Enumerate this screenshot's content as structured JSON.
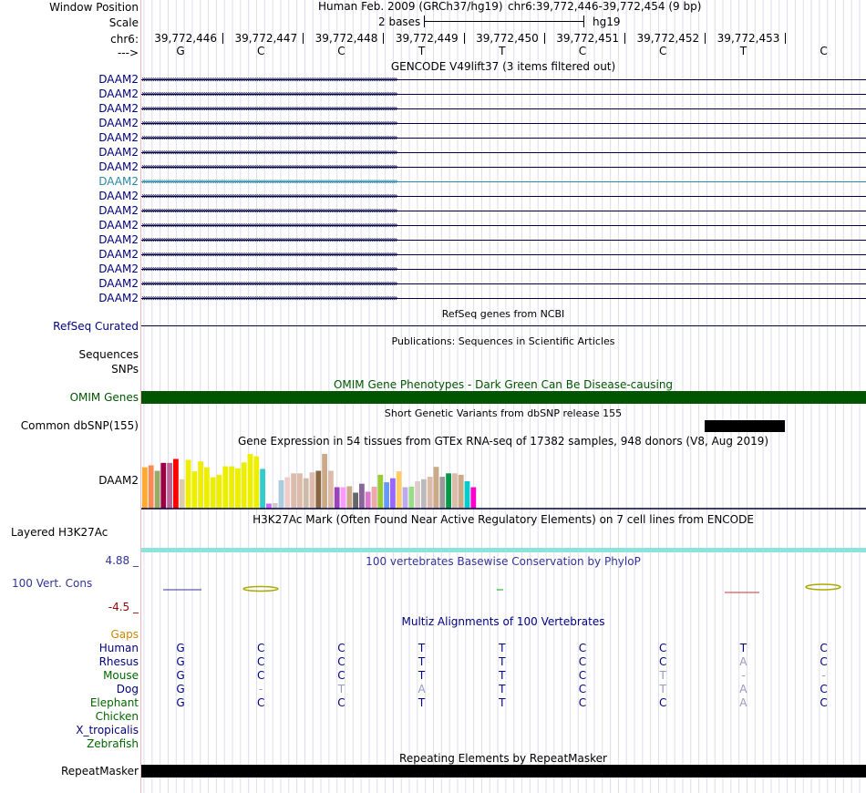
{
  "header": {
    "window_position_label": "Window Position",
    "scale_label": "Scale",
    "chrom_label": "chr6:",
    "strand_label": "--->",
    "assembly_text": "Human Feb. 2009 (GRCh37/hg19)",
    "position_text": "chr6:39,772,446-39,772,454 (9 bp)",
    "scale_bases": "2 bases",
    "scale_db": "hg19",
    "coordinates": [
      "39,772,446",
      "39,772,447",
      "39,772,448",
      "39,772,449",
      "39,772,450",
      "39,772,451",
      "39,772,452",
      "39,772,453"
    ],
    "bases": [
      "G",
      "C",
      "C",
      "T",
      "T",
      "C",
      "C",
      "T",
      "C"
    ]
  },
  "gencode": {
    "title": "GENCODE V49lift37 (3 items filtered out)",
    "gene_label": "DAAM2",
    "row_count": 16,
    "highlighted_row": 7,
    "colors": {
      "gene": "#000080",
      "highlight": "#2a87a8"
    }
  },
  "refseq": {
    "label": "RefSeq Curated",
    "title": "RefSeq genes from NCBI"
  },
  "publications": {
    "title": "Publications: Sequences in Scientific Articles",
    "sequences_label": "Sequences",
    "snps_label": "SNPs"
  },
  "omim": {
    "label": "OMIM Genes",
    "title": "OMIM Gene Phenotypes - Dark Green Can Be Disease-causing",
    "color": "#005500"
  },
  "dbsnp": {
    "label": "Common dbSNP(155)",
    "title": "Short Genetic Variants from dbSNP release 155"
  },
  "gtex": {
    "label": "DAAM2",
    "title": "Gene Expression in 54 tissues from GTEx RNA-seq of 17382 samples, 948 donors (V8, Aug 2019)",
    "bars": [
      {
        "h": 0.83,
        "c": "#ffaa33"
      },
      {
        "h": 0.87,
        "c": "#ff8855"
      },
      {
        "h": 0.76,
        "c": "#99aa66"
      },
      {
        "h": 0.92,
        "c": "#990044"
      },
      {
        "h": 0.92,
        "c": "#bb6699"
      },
      {
        "h": 1.0,
        "c": "#ff0000"
      },
      {
        "h": 0.59,
        "c": "#ddccaa"
      },
      {
        "h": 0.98,
        "c": "#eeee00"
      },
      {
        "h": 0.75,
        "c": "#eeee00"
      },
      {
        "h": 0.95,
        "c": "#eeee00"
      },
      {
        "h": 0.83,
        "c": "#eeee00"
      },
      {
        "h": 0.63,
        "c": "#eeee00"
      },
      {
        "h": 0.68,
        "c": "#eeee00"
      },
      {
        "h": 0.85,
        "c": "#eeee00"
      },
      {
        "h": 0.85,
        "c": "#eeee00"
      },
      {
        "h": 0.81,
        "c": "#eeee00"
      },
      {
        "h": 0.93,
        "c": "#eeee00"
      },
      {
        "h": 1.1,
        "c": "#eeee00"
      },
      {
        "h": 1.05,
        "c": "#eeee00"
      },
      {
        "h": 0.8,
        "c": "#33cccc"
      },
      {
        "h": 0.1,
        "c": "#cc66ff"
      },
      {
        "h": 0.11,
        "c": "#cccccc"
      },
      {
        "h": 0.57,
        "c": "#aaccdd"
      },
      {
        "h": 0.63,
        "c": "#eecccc"
      },
      {
        "h": 0.71,
        "c": "#ddbbaa"
      },
      {
        "h": 0.71,
        "c": "#ddbbaa"
      },
      {
        "h": 0.61,
        "c": "#ccbbaa"
      },
      {
        "h": 0.73,
        "c": "#ddbbaa"
      },
      {
        "h": 0.76,
        "c": "#886644"
      },
      {
        "h": 1.1,
        "c": "#ccaa88"
      },
      {
        "h": 0.76,
        "c": "#ddbbaa"
      },
      {
        "h": 0.43,
        "c": "#9944bb"
      },
      {
        "h": 0.43,
        "c": "#ff99ff"
      },
      {
        "h": 0.45,
        "c": "#ccaa88"
      },
      {
        "h": 0.32,
        "c": "#666666"
      },
      {
        "h": 0.5,
        "c": "#886699"
      },
      {
        "h": 0.34,
        "c": "#dd77cc"
      },
      {
        "h": 0.44,
        "c": "#eeaaaa"
      },
      {
        "h": 0.68,
        "c": "#99cc33"
      },
      {
        "h": 0.53,
        "c": "#6699ff"
      },
      {
        "h": 0.61,
        "c": "#9966ff"
      },
      {
        "h": 0.75,
        "c": "#ffcc66"
      },
      {
        "h": 0.43,
        "c": "#bbaaee"
      },
      {
        "h": 0.44,
        "c": "#99dd88"
      },
      {
        "h": 0.55,
        "c": "#ddcccc"
      },
      {
        "h": 0.59,
        "c": "#bbbbbb"
      },
      {
        "h": 0.64,
        "c": "#ddbbaa"
      },
      {
        "h": 0.84,
        "c": "#ccaa88"
      },
      {
        "h": 0.64,
        "c": "#999999"
      },
      {
        "h": 0.71,
        "c": "#009944"
      },
      {
        "h": 0.71,
        "c": "#ddbbaa"
      },
      {
        "h": 0.68,
        "c": "#ccaa88"
      },
      {
        "h": 0.55,
        "c": "#00cccc"
      },
      {
        "h": 0.43,
        "c": "#ff00cc"
      }
    ]
  },
  "h3k27ac": {
    "label": "Layered H3K27Ac",
    "title": "H3K27Ac Mark (Often Found Near Active Regulatory Elements) on 7 cell lines from ENCODE",
    "color": "#8fe3dd"
  },
  "cons": {
    "label": "100 Vert. Cons",
    "max": "4.88 _",
    "min": "-4.5 _",
    "title": "100 vertebrates Basewise Conservation by PhyloP",
    "title_color": "#333399",
    "max_color": "#333399",
    "min_color": "#990000"
  },
  "multiz": {
    "title": "Multiz Alignments of 100 Vertebrates",
    "gaps_label": "Gaps",
    "species": [
      {
        "name": "Human",
        "color": "#000080",
        "bases": [
          "G",
          "C",
          "C",
          "T",
          "T",
          "C",
          "C",
          "T",
          "C"
        ],
        "faded": [
          false,
          false,
          false,
          false,
          false,
          false,
          false,
          false,
          false
        ]
      },
      {
        "name": "Rhesus",
        "color": "#000080",
        "bases": [
          "G",
          "C",
          "C",
          "T",
          "T",
          "C",
          "C",
          "A",
          "C"
        ],
        "faded": [
          false,
          false,
          false,
          false,
          false,
          false,
          false,
          true,
          false
        ]
      },
      {
        "name": "Mouse",
        "color": "#006600",
        "bases": [
          "G",
          "C",
          "C",
          "T",
          "T",
          "C",
          "T",
          "-",
          "-"
        ],
        "faded": [
          false,
          false,
          false,
          false,
          false,
          false,
          true,
          true,
          true
        ]
      },
      {
        "name": "Dog",
        "color": "#000080",
        "bases": [
          "G",
          "-",
          "T",
          "A",
          "T",
          "C",
          "T",
          "A",
          "C"
        ],
        "faded": [
          false,
          true,
          true,
          true,
          false,
          false,
          true,
          true,
          false
        ]
      },
      {
        "name": "Elephant",
        "color": "#006600",
        "bases": [
          "G",
          "C",
          "C",
          "T",
          "T",
          "C",
          "C",
          "A",
          "C"
        ],
        "faded": [
          false,
          false,
          false,
          false,
          false,
          false,
          false,
          true,
          false
        ]
      },
      {
        "name": "Chicken",
        "color": "#006600",
        "bases": [],
        "faded": []
      },
      {
        "name": "X_tropicalis",
        "color": "#000080",
        "bases": [],
        "faded": []
      },
      {
        "name": "Zebrafish",
        "color": "#006600",
        "bases": [],
        "faded": []
      }
    ]
  },
  "repeatmasker": {
    "label": "RepeatMasker",
    "title": "Repeating Elements by RepeatMasker"
  }
}
